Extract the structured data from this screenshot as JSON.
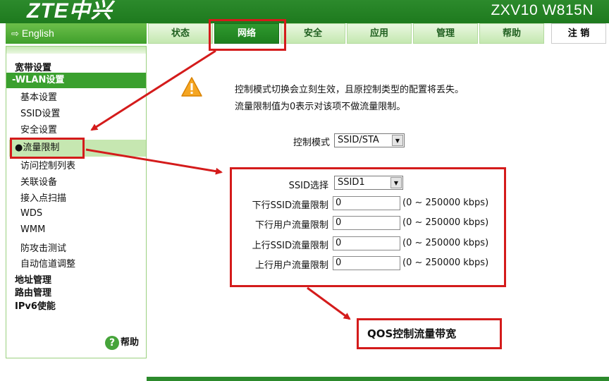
{
  "header": {
    "logo": "ZTE中兴",
    "model": "ZXV10 W815N"
  },
  "lang": {
    "label": "English"
  },
  "tabs": [
    {
      "label": "状态"
    },
    {
      "label": "网络"
    },
    {
      "label": "安全"
    },
    {
      "label": "应用"
    },
    {
      "label": "管理"
    },
    {
      "label": "帮助"
    }
  ],
  "logout": "注 销",
  "sidebar": {
    "sections": [
      "宽带设置",
      "-WLAN设置",
      "地址管理",
      "路由管理",
      "IPv6使能"
    ],
    "items": [
      "基本设置",
      "SSID设置",
      "安全设置",
      "●流量限制",
      "访问控制列表",
      "关联设备",
      "接入点扫描",
      "WDS",
      "WMM",
      "防攻击测试",
      "自动信道调整"
    ],
    "help": "帮助"
  },
  "notice": {
    "line1": "控制模式切换会立刻生效，且原控制类型的配置将丢失。",
    "line2": "流量限制值为0表示对该项不做流量限制。"
  },
  "control_mode": {
    "label": "控制模式",
    "value": "SSID/STA"
  },
  "ssid_select": {
    "label": "SSID选择",
    "value": "SSID1"
  },
  "fields": [
    {
      "label": "下行SSID流量限制",
      "value": "0",
      "hint": "(0 ~ 250000 kbps)"
    },
    {
      "label": "下行用户流量限制",
      "value": "0",
      "hint": "(0 ~ 250000 kbps)"
    },
    {
      "label": "上行SSID流量限制",
      "value": "0",
      "hint": "(0 ~ 250000 kbps)"
    },
    {
      "label": "上行用户流量限制",
      "value": "0",
      "hint": "(0 ~ 250000 kbps)"
    }
  ],
  "annotation": "QOS控制流量带宽",
  "colors": {
    "brand_green": "#2c8a2c",
    "annotation_red": "#d41b1b"
  }
}
